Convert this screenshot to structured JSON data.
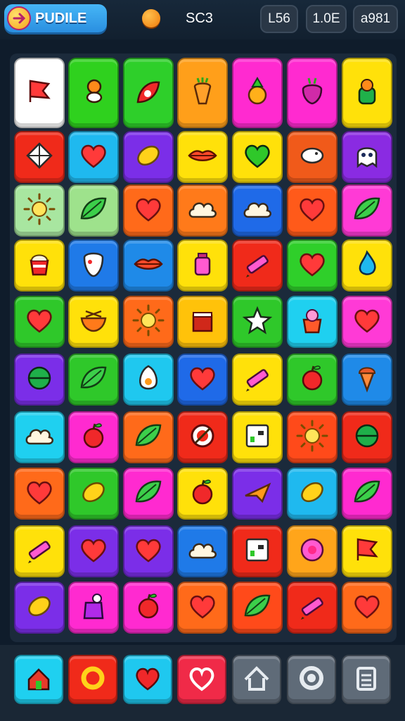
{
  "header": {
    "title": "PUDILE",
    "coin_value": "SC3",
    "stats": [
      "L56",
      "1.0E",
      "a981"
    ],
    "brand_color": "#2a8fe0",
    "coin_icon": "coin-icon"
  },
  "grid": {
    "rows": [
      [
        {
          "icon": "flag",
          "color": "#ffffff"
        },
        {
          "icon": "bird",
          "color": "#2fd11e"
        },
        {
          "icon": "leaf-eye",
          "color": "#2ecf2a"
        },
        {
          "icon": "carrot",
          "color": "#ff9f1a"
        },
        {
          "icon": "pineapple",
          "color": "#ff2ad0"
        },
        {
          "icon": "radish",
          "color": "#ff2ad0"
        },
        {
          "icon": "cat",
          "color": "#ffe10a"
        }
      ],
      [
        {
          "icon": "diamond",
          "color": "#f02a1a"
        },
        {
          "icon": "heart",
          "color": "#1fb9ef"
        },
        {
          "icon": "lemon",
          "color": "#7b2ee8"
        },
        {
          "icon": "lips",
          "color": "#ffe10a"
        },
        {
          "icon": "heart-leaf",
          "color": "#ffe10a"
        },
        {
          "icon": "fish",
          "color": "#f05a1a"
        },
        {
          "icon": "ghost",
          "color": "#8a2be2"
        }
      ],
      [
        {
          "icon": "sun",
          "color": "#a8e6a0"
        },
        {
          "icon": "leaf",
          "color": "#9ee28c"
        },
        {
          "icon": "heart",
          "color": "#ff6a1a"
        },
        {
          "icon": "cloud",
          "color": "#ff7a1a"
        },
        {
          "icon": "cloud",
          "color": "#1f6ae8"
        },
        {
          "icon": "heart",
          "color": "#ff5a1a"
        },
        {
          "icon": "leaf",
          "color": "#ff3ad6"
        }
      ],
      [
        {
          "icon": "cup",
          "color": "#ffe10a"
        },
        {
          "icon": "mask",
          "color": "#1f7ae8"
        },
        {
          "icon": "lips",
          "color": "#1f8ae8"
        },
        {
          "icon": "jar",
          "color": "#ffe10a"
        },
        {
          "icon": "pencil",
          "color": "#f02a1a"
        },
        {
          "icon": "heart",
          "color": "#2fcf2a"
        },
        {
          "icon": "drop",
          "color": "#ffe10a"
        }
      ],
      [
        {
          "icon": "heart",
          "color": "#2fc82a"
        },
        {
          "icon": "bowl",
          "color": "#ffe10a"
        },
        {
          "icon": "sun",
          "color": "#ff6a1a"
        },
        {
          "icon": "box",
          "color": "#ffc20a"
        },
        {
          "icon": "star",
          "color": "#2fc82a"
        },
        {
          "icon": "pot",
          "color": "#1fd0f0"
        },
        {
          "icon": "heart",
          "color": "#ff3ad6"
        }
      ],
      [
        {
          "icon": "ball",
          "color": "#7b2ee8"
        },
        {
          "icon": "leaf",
          "color": "#2fc82a"
        },
        {
          "icon": "egg",
          "color": "#1fc8ef"
        },
        {
          "icon": "heart",
          "color": "#1f6ae8"
        },
        {
          "icon": "pencil",
          "color": "#ffe10a"
        },
        {
          "icon": "apple",
          "color": "#2fc82a"
        },
        {
          "icon": "cone",
          "color": "#1f8ae8"
        }
      ],
      [
        {
          "icon": "cloud",
          "color": "#1fd0f0"
        },
        {
          "icon": "apple",
          "color": "#ff2ad0"
        },
        {
          "icon": "leaf",
          "color": "#ff6a1a"
        },
        {
          "icon": "target",
          "color": "#f02a1a"
        },
        {
          "icon": "note",
          "color": "#ffe10a"
        },
        {
          "icon": "sun",
          "color": "#ff4a1a"
        },
        {
          "icon": "ball",
          "color": "#f02a1a"
        }
      ],
      [
        {
          "icon": "heart",
          "color": "#ff6a1a"
        },
        {
          "icon": "lemon",
          "color": "#2fc82a"
        },
        {
          "icon": "leaf",
          "color": "#ff2ad0"
        },
        {
          "icon": "apple",
          "color": "#ffe10a"
        },
        {
          "icon": "plane",
          "color": "#7b2ee8"
        },
        {
          "icon": "lemon",
          "color": "#1fb9ef"
        },
        {
          "icon": "leaf",
          "color": "#ff2ad0"
        }
      ],
      [
        {
          "icon": "pencil",
          "color": "#ffe10a"
        },
        {
          "icon": "heart",
          "color": "#7b2ee8"
        },
        {
          "icon": "heart",
          "color": "#7b2ee8"
        },
        {
          "icon": "cloud",
          "color": "#1f7ae8"
        },
        {
          "icon": "note",
          "color": "#f02a1a"
        },
        {
          "icon": "flower",
          "color": "#ffa51a"
        },
        {
          "icon": "flag",
          "color": "#ffe10a"
        }
      ],
      [
        {
          "icon": "lemon",
          "color": "#7b2ee8"
        },
        {
          "icon": "bag",
          "color": "#ff2ad0"
        },
        {
          "icon": "apple",
          "color": "#ff2ad0"
        },
        {
          "icon": "heart",
          "color": "#ff6a1a"
        },
        {
          "icon": "leaf",
          "color": "#ff4a1a"
        },
        {
          "icon": "pencil",
          "color": "#f02a1a"
        },
        {
          "icon": "heart",
          "color": "#ff6a1a"
        }
      ]
    ]
  },
  "nav": [
    {
      "icon": "house-icon",
      "color": "#1fd0f0"
    },
    {
      "icon": "ring-icon",
      "color": "#f02a1a"
    },
    {
      "icon": "heart-icon",
      "color": "#1fc8ef"
    },
    {
      "icon": "heart-outline-icon",
      "color": "#f02a48"
    },
    {
      "icon": "home-icon",
      "color": "#5f6b78"
    },
    {
      "icon": "settings-icon",
      "color": "#5f6b78"
    },
    {
      "icon": "clipboard-icon",
      "color": "#5f6b78"
    }
  ]
}
